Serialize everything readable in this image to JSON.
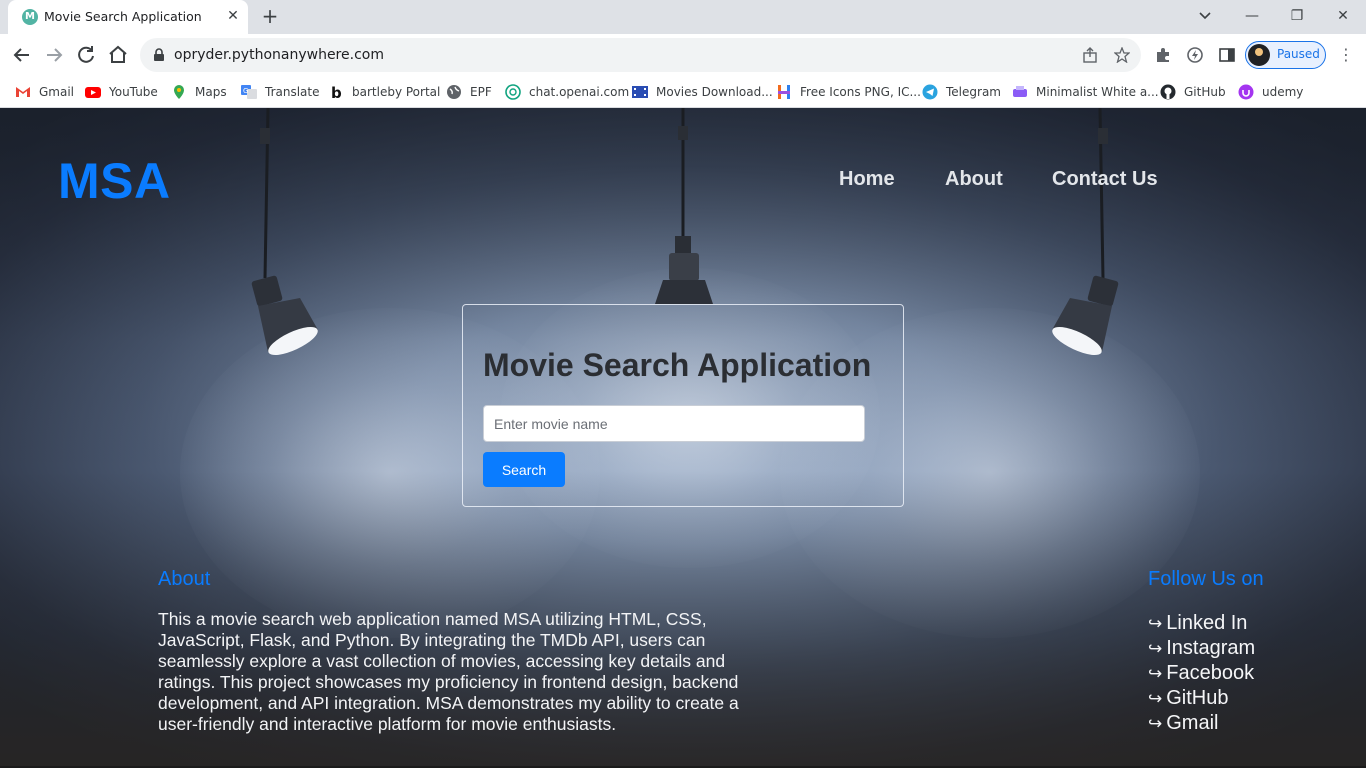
{
  "browser": {
    "tab": {
      "title": "Movie Search Application",
      "favicon_letter": "M"
    },
    "new_tab_symbol": "+",
    "close_symbol": "✕",
    "window_controls": {
      "minimize": "—",
      "restore": "❐",
      "close": "✕"
    },
    "url": "opryder.pythonanywhere.com",
    "profile_status": "Paused",
    "menu_symbol": "⋮",
    "bookmarks": [
      {
        "label": "Gmail",
        "color": "#ea4335"
      },
      {
        "label": "YouTube",
        "color": "#ff0000"
      },
      {
        "label": "Maps",
        "color": "#34a853"
      },
      {
        "label": "Translate",
        "color": "#4285f4"
      },
      {
        "label": "bartleby Portal",
        "color": "#111111"
      },
      {
        "label": "EPF",
        "color": "#444444"
      },
      {
        "label": "chat.openai.com",
        "color": "#10a37f"
      },
      {
        "label": "Movies Download...",
        "color": "#2a4db3"
      },
      {
        "label": "Free Icons PNG, IC...",
        "color": "#f26b1d"
      },
      {
        "label": "Telegram",
        "color": "#2aa3df"
      },
      {
        "label": "Minimalist White a...",
        "color": "#8b5cf6"
      },
      {
        "label": "GitHub",
        "color": "#24292e"
      },
      {
        "label": "udemy",
        "color": "#a435f0"
      }
    ]
  },
  "site": {
    "logo": "MSA",
    "nav": [
      "Home",
      "About",
      "Contact Us"
    ],
    "search": {
      "title": "Movie Search Application",
      "placeholder": "Enter movie name",
      "button": "Search"
    },
    "footer": {
      "about_heading": "About",
      "about_text": "This a movie search web application named MSA utilizing HTML, CSS, JavaScript, Flask, and Python. By integrating the TMDb API, users can seamlessly explore a vast collection of movies, accessing key details and ratings. This project showcases my proficiency in frontend design, backend development, and API integration. MSA demonstrates my ability to create a user-friendly and interactive platform for movie enthusiasts.",
      "follow_heading": "Follow Us on",
      "arrow": "↪",
      "links": [
        "Linked In",
        "Instagram",
        "Facebook",
        "GitHub",
        "Gmail"
      ]
    },
    "colors": {
      "accent": "#0a7cff",
      "nav_text": "#e3e6ea",
      "card_title": "#2b2e33"
    }
  }
}
